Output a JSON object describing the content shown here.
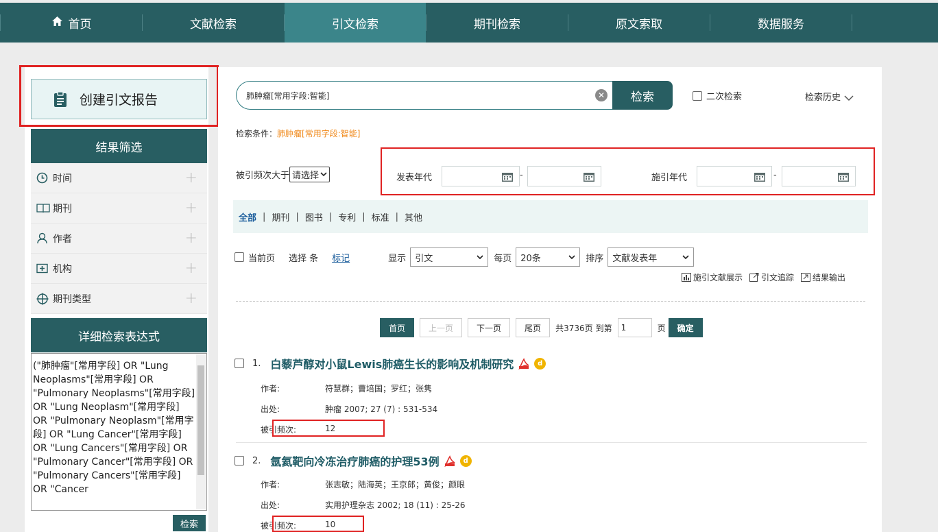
{
  "nav": {
    "items": [
      {
        "label": "首页"
      },
      {
        "label": "文献检索"
      },
      {
        "label": "引文检索"
      },
      {
        "label": "期刊检索"
      },
      {
        "label": "原文索取"
      },
      {
        "label": "数据服务"
      }
    ],
    "active_index": 2
  },
  "sidebar": {
    "create_report": "创建引文报告",
    "filter_title": "结果筛选",
    "filters": [
      {
        "label": "时间",
        "icon": "clock-icon"
      },
      {
        "label": "期刊",
        "icon": "book-icon"
      },
      {
        "label": "作者",
        "icon": "person-icon"
      },
      {
        "label": "机构",
        "icon": "institution-icon"
      },
      {
        "label": "期刊类型",
        "icon": "crosshair-icon"
      }
    ],
    "expr_title": "详细检索表达式",
    "expression": "(\"肺肿瘤\"[常用字段] OR \"Lung Neoplasms\"[常用字段] OR \"Pulmonary Neoplasms\"[常用字段] OR \"Lung Neoplasm\"[常用字段] OR \"Pulmonary Neoplasm\"[常用字段] OR \"Lung Cancer\"[常用字段] OR \"Lung Cancers\"[常用字段] OR \"Pulmonary Cancer\"[常用字段] OR \"Pulmonary Cancers\"[常用字段] OR \"Cancer",
    "search_button": "检索"
  },
  "search": {
    "query": "肺肿瘤[常用字段:智能]",
    "button": "检索",
    "secondary_search": "二次检索",
    "history": "检索历史"
  },
  "condition": {
    "label": "检索条件：",
    "value": "肺肿瘤[常用字段:智能]"
  },
  "freq": {
    "label": "被引频次大于",
    "select": "请选择"
  },
  "dates": {
    "publish_label": "发表年代",
    "cite_label": "施引年代",
    "dash": "-"
  },
  "types": {
    "items": [
      "全部",
      "期刊",
      "图书",
      "专利",
      "标准",
      "其他"
    ],
    "separator": "|"
  },
  "toolbar": {
    "current_page": "当前页",
    "select_count": "选择 条",
    "mark": "标记",
    "display_label": "显示",
    "display_value": "引文",
    "per_page_label": "每页",
    "per_page_value": "20条",
    "sort_label": "排序",
    "sort_value": "文献发表年"
  },
  "actions": {
    "cited_display": "施引文献展示",
    "trace": "引文追踪",
    "export": "结果输出"
  },
  "pager": {
    "first": "首页",
    "prev": "上一页",
    "next": "下一页",
    "last": "尾页",
    "total": "共3736页",
    "goto": "到第",
    "page_value": "1",
    "page_unit": "页",
    "confirm": "确定"
  },
  "results": [
    {
      "num": "1.",
      "title": "白藜芦醇对小鼠Lewis肺癌生长的影响及机制研究",
      "author_label": "作者:",
      "authors": "符慧群；曹培国；罗红；张隽",
      "source_label": "出处:",
      "source": "肿瘤 2007; 27 (7) : 531-534",
      "cited_label": "被引频次:",
      "cited": "12"
    },
    {
      "num": "2.",
      "title": "氩氦靶向冷冻治疗肺癌的护理53例",
      "author_label": "作者:",
      "authors": "张志敏；陆海英；王京郎；黄俊；颜眼",
      "source_label": "出处:",
      "source": "实用护理杂志 2002; 18 (11) : 25-26",
      "cited_label": "被引频次:",
      "cited": "10"
    }
  ],
  "colors": {
    "nav_bg": "#285e62",
    "nav_active": "#3b858a",
    "highlight_red": "#e02222",
    "condition_orange": "#f08a1c",
    "title_teal": "#1f5c66"
  }
}
